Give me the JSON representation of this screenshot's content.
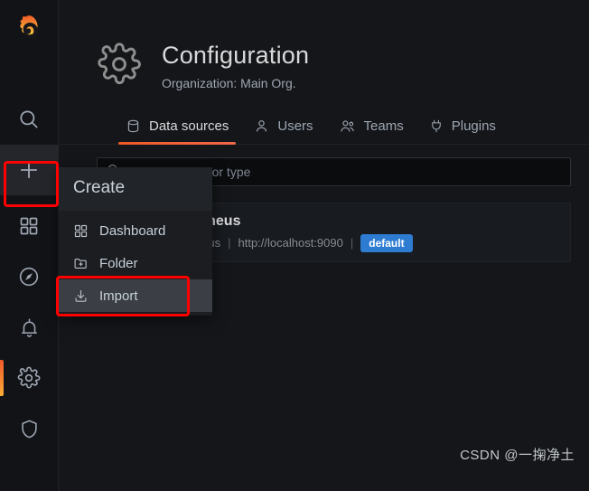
{
  "sidebar": {
    "logo": "grafana-logo",
    "items": [
      {
        "name": "search",
        "icon": "search-icon"
      },
      {
        "name": "create",
        "icon": "plus-icon",
        "active": true
      },
      {
        "name": "dashboards",
        "icon": "grid-icon"
      },
      {
        "name": "explore",
        "icon": "compass-icon"
      },
      {
        "name": "alerting",
        "icon": "bell-icon"
      },
      {
        "name": "configuration",
        "icon": "gear-icon",
        "active": true
      },
      {
        "name": "server-admin",
        "icon": "shield-icon"
      }
    ]
  },
  "header": {
    "icon": "gear-icon",
    "title": "Configuration",
    "subtitle": "Organization: Main Org."
  },
  "tabs": [
    {
      "label": "Data sources",
      "icon": "database-icon",
      "active": true
    },
    {
      "label": "Users",
      "icon": "user-icon",
      "active": false
    },
    {
      "label": "Teams",
      "icon": "users-icon",
      "active": false
    },
    {
      "label": "Plugins",
      "icon": "plug-icon",
      "active": false
    }
  ],
  "search": {
    "icon": "search-icon",
    "placeholder": "Filter by name or type",
    "value": ""
  },
  "datasources": [
    {
      "name": "Prometheus",
      "type": "Prometheus",
      "url": "http://localhost:9090",
      "badge": "default",
      "logo": "prometheus-logo"
    }
  ],
  "create_menu": {
    "header": "Create",
    "items": [
      {
        "label": "Dashboard",
        "icon": "dashboard-icon",
        "hovered": false
      },
      {
        "label": "Folder",
        "icon": "folder-plus-icon",
        "hovered": false
      },
      {
        "label": "Import",
        "icon": "import-icon",
        "hovered": true
      }
    ]
  },
  "annotations": {
    "highlight_color": "#fe0000",
    "targets": [
      "create-plus-button",
      "import-menu-item"
    ]
  },
  "watermark": {
    "text": "CSDN @一掬净土"
  },
  "colors": {
    "accent_orange": "#f05a28",
    "badge_blue": "#2d7cd2",
    "bg_page": "#141619",
    "bg_sidebar": "#111317",
    "bg_menu": "#1b1d21"
  }
}
